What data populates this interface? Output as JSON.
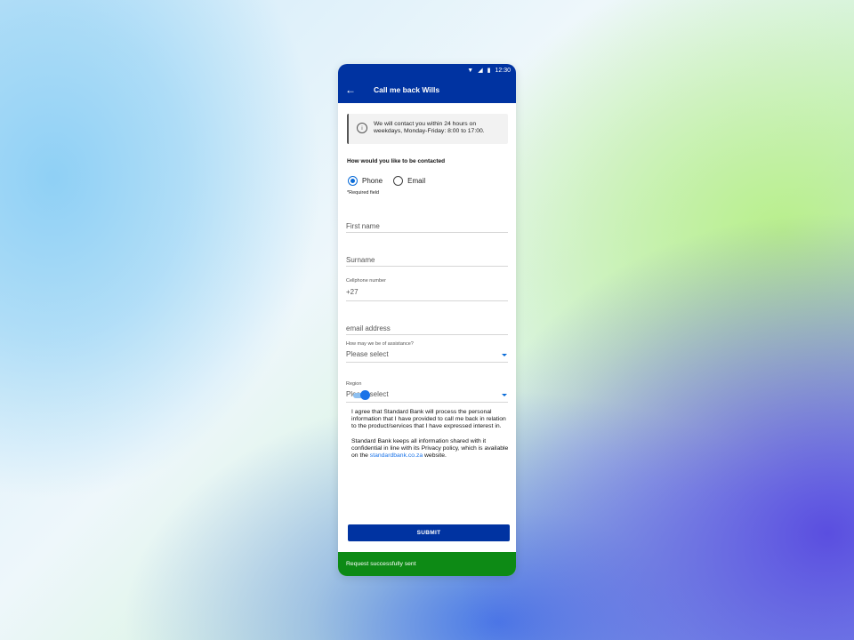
{
  "status_bar": {
    "time": "12:30",
    "icons": [
      "wifi-icon",
      "signal-icon",
      "battery-icon"
    ]
  },
  "app_bar": {
    "title": "Call me back Wills",
    "back_icon": "arrow-left-icon"
  },
  "info_box": {
    "icon": "info-icon",
    "text": "We will contact you within 24 hours on weekdays, Monday-Friday: 8:00 to 17:00."
  },
  "contact_question": "How would you like to be contacted",
  "contact_options": [
    {
      "label": "Phone",
      "selected": true
    },
    {
      "label": "Email",
      "selected": false
    }
  ],
  "required_note": "*Required field",
  "fields": {
    "first_name": {
      "placeholder": "First name"
    },
    "surname": {
      "placeholder": "Surname"
    },
    "cellphone": {
      "label": "Cellphone number",
      "value": "+27"
    },
    "email": {
      "placeholder": "email address"
    },
    "assistance": {
      "label": "How may we be of assistance?",
      "value": "Please select"
    },
    "region": {
      "label": "Region",
      "value": "Please select"
    }
  },
  "consent": {
    "toggle_on": true,
    "paragraph1": "I agree that Standard Bank will process the personal information that I have provided to call me back in relation to the product/services that I have expressed interest in.",
    "paragraph2_prefix": "Standard Bank keeps all information shared with it confidential in line with its Privacy policy, which is available on the",
    "link_text": "standardbank.co.za",
    "paragraph2_suffix": "website."
  },
  "submit_label": "SUBMIT",
  "snackbar_text": "Request successfully sent",
  "colors": {
    "brand_blue": "#0033a1",
    "accent_blue": "#1a73e8",
    "success_green": "#0d8a15"
  }
}
